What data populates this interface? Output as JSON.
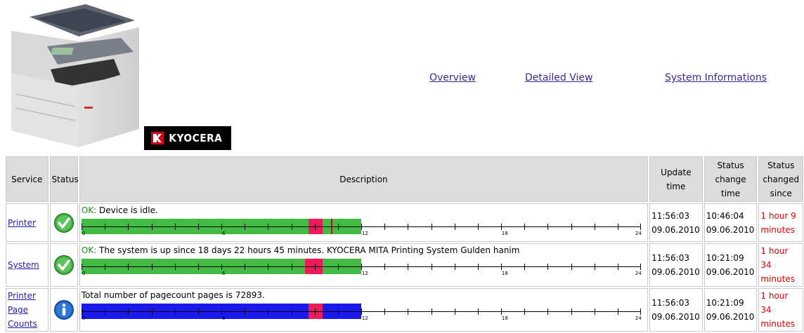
{
  "header": {
    "logo_text": "KYOCERA",
    "nav": [
      {
        "label": "Overview"
      },
      {
        "label": "Detailed View"
      },
      {
        "label": "System Informations"
      }
    ]
  },
  "table": {
    "columns": [
      "Service",
      "Status",
      "Description",
      "Update time",
      "Status change time",
      "Status changed since"
    ],
    "rows": [
      {
        "service": "Printer",
        "status_icon": "ok-check-icon",
        "status_prefix": "OK:",
        "description": " Device is idle.",
        "update_time": "11:56:03",
        "update_date": "09.06.2010",
        "change_time": "10:46:04",
        "change_date": "09.06.2010",
        "since": "1 hour 9 minutes",
        "timeline": [
          {
            "from": 0,
            "to": 9.75,
            "color": "#44bb44"
          },
          {
            "from": 9.75,
            "to": 10.35,
            "color": "#ee1a5a"
          },
          {
            "from": 10.35,
            "to": 12,
            "color": "#44bb44"
          }
        ],
        "timeline_mark": 10.7
      },
      {
        "service": "System",
        "status_icon": "ok-check-icon",
        "status_prefix": "OK:",
        "description": " The system is up since 18 days 22 hours 45 minutes. KYOCERA MITA Printing System Gulden hanim",
        "update_time": "11:56:03",
        "update_date": "09.06.2010",
        "change_time": "10:21:09",
        "change_date": "09.06.2010",
        "since": "1 hour 34 minutes",
        "timeline": [
          {
            "from": 0,
            "to": 9.6,
            "color": "#44bb44"
          },
          {
            "from": 9.6,
            "to": 10.35,
            "color": "#ee1a5a"
          },
          {
            "from": 10.35,
            "to": 12,
            "color": "#44bb44"
          }
        ]
      },
      {
        "service": "Printer Page Counts",
        "status_icon": "info-icon",
        "status_prefix": "",
        "description": "Total number of pagecount pages is 72893.",
        "update_time": "11:56:03",
        "update_date": "09.06.2010",
        "change_time": "10:21:09",
        "change_date": "09.06.2010",
        "since": "1 hour 34 minutes",
        "timeline": [
          {
            "from": 0,
            "to": 9.75,
            "color": "#1a1aee"
          },
          {
            "from": 9.75,
            "to": 10.35,
            "color": "#ee1a5a"
          },
          {
            "from": 10.35,
            "to": 12,
            "color": "#1a1aee"
          }
        ]
      }
    ],
    "axis": {
      "min": 0,
      "max": 24,
      "labels": [
        0,
        6,
        12,
        18,
        24
      ],
      "tick_step": 1
    }
  }
}
